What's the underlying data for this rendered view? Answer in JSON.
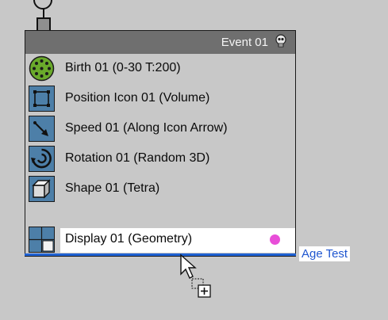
{
  "event": {
    "title": "Event 01"
  },
  "operators": [
    {
      "label": "Birth 01 (0-30 T:200)",
      "icon": "birth-icon"
    },
    {
      "label": "Position Icon 01 (Volume)",
      "icon": "position-icon"
    },
    {
      "label": "Speed 01 (Along Icon Arrow)",
      "icon": "speed-icon"
    },
    {
      "label": "Rotation 01 (Random 3D)",
      "icon": "rotation-icon"
    },
    {
      "label": "Shape 01 (Tetra)",
      "icon": "shape-icon"
    },
    {
      "label": "Display 01 (Geometry)",
      "icon": "display-icon"
    }
  ],
  "drag_target_label": "Age Test",
  "colors": {
    "background": "#c8c8c8",
    "header": "#6f6f6f",
    "operator_icon": "#4d7fa8",
    "birth_icon": "#6aaa2b",
    "display_dot": "#e84ed8",
    "drop_indicator": "#1f62d4",
    "drag_label_text": "#1f56d0"
  }
}
